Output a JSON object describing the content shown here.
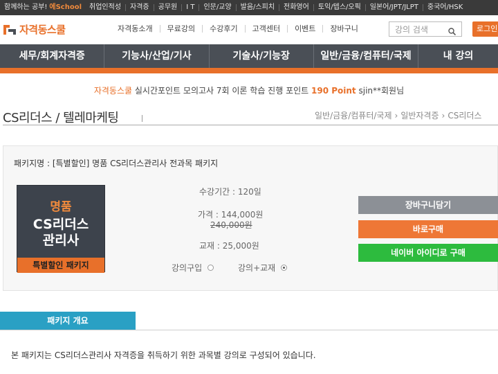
{
  "topbar": {
    "tagline": "함께하는 공부!",
    "school": "에School",
    "items": [
      "취업인적성",
      "자격증",
      "공무원",
      "I T",
      "인문/교양",
      "발음/스피치",
      "전화영어",
      "토익/텝스/오픽",
      "일본어/JPT/JLPT",
      "중국어/HSK"
    ]
  },
  "header": {
    "logo_text": "자격동스쿨",
    "nav": [
      "자격동소개",
      "무료강의",
      "수강후기",
      "고객센터",
      "이벤트",
      "장바구니"
    ],
    "search_placeholder": "강의 검색",
    "login_label": "로그인"
  },
  "category_nav": [
    "세무/회계자격증",
    "기능사/산업/기사",
    "기술사/기능장",
    "일반/금융/컴퓨터/국제",
    "내 강의"
  ],
  "ticker": {
    "brand": "자격동스쿨",
    "text_1": " 실시간포인트 모의고사 7회 이론 학습 진행 포인트 ",
    "points": "190 Point",
    "text_2": " sjin**회원님"
  },
  "page": {
    "title": "CS리더스 / 텔레마케팅",
    "breadcrumb": [
      "일반/금융/컴퓨터/국제",
      "일반자격증",
      "CS리더스"
    ]
  },
  "package": {
    "name": "패키지명 : [특별할인] 명품 CS리더스관리사 전과목 패키지",
    "thumb_line1": "명품",
    "thumb_line2": "CS리더스",
    "thumb_line3": "관리사",
    "thumb_band": "특별할인 패키지",
    "period": "수강기간 : 120일",
    "price": "가격 : 144,000원",
    "original_price": "240,000원",
    "book": "교재 : 25,000원",
    "option_1": "강의구입",
    "option_2": "강의+교재",
    "selected_option": "강의+교재"
  },
  "buttons": {
    "cart": "장바구니담기",
    "buy": "바로구매",
    "naver": "네이버 아이디로 구매"
  },
  "overview": {
    "tab": "패키지 개요",
    "description": "본 패키지는 CS리더스관리사 자격증을 취득하기 위한 과목별 강의로 구성되어 있습니다."
  },
  "colors": {
    "accent": "#e8702a",
    "nav_bg": "#4a4f56",
    "topbar_bg": "#3a3a3a",
    "cart_btn": "#8c9096",
    "buy_btn": "#ee7736",
    "naver_btn": "#2dbb3e",
    "tab_blue": "#2aa0c4"
  }
}
